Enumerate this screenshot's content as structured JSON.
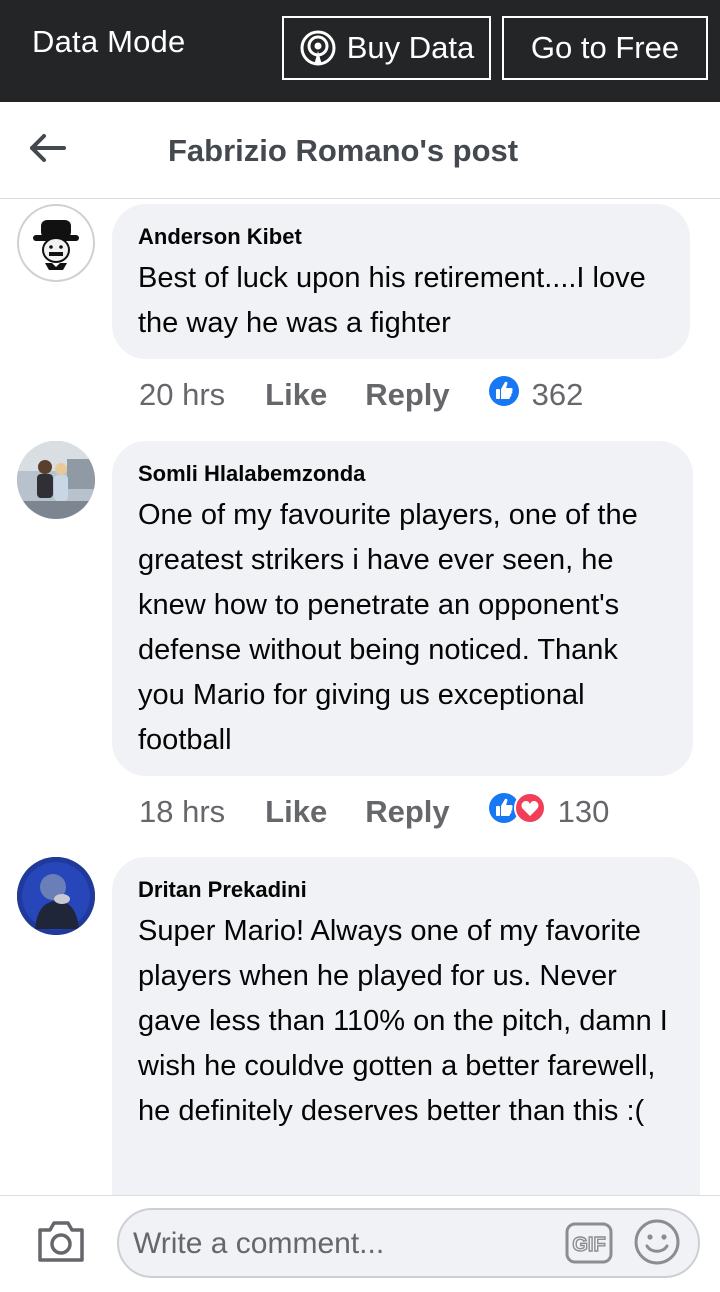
{
  "topbar": {
    "mode_label": "Data Mode",
    "buy_data_label": "Buy Data",
    "go_free_label": "Go to Free"
  },
  "header": {
    "title": "Fabrizio Romano's post"
  },
  "comments": [
    {
      "author": "Anderson Kibet",
      "text": "Best of luck upon his retirement....I love the way he was a fighter",
      "time": "20 hrs",
      "like_label": "Like",
      "reply_label": "Reply",
      "reactions": [
        "like"
      ],
      "reaction_count": "362"
    },
    {
      "author": "Somli Hlalabemzonda",
      "text": "One of my favourite players, one of the greatest strikers i have ever seen, he knew how to penetrate an opponent's defense without being noticed. Thank you Mario for giving us exceptional football",
      "time": "18 hrs",
      "like_label": "Like",
      "reply_label": "Reply",
      "reactions": [
        "like",
        "love"
      ],
      "reaction_count": "130"
    },
    {
      "author": "Dritan Prekadini",
      "text": "Super Mario! Always one of my favorite players when he played for us. Never gave less than 110% on the pitch, damn I wish he couldve gotten a better farewell, he definitely deserves better than this :(",
      "time": "",
      "like_label": "",
      "reply_label": "",
      "reactions": [],
      "reaction_count": ""
    }
  ],
  "composer": {
    "placeholder": "Write a comment..."
  },
  "colors": {
    "topbar_bg": "#242526",
    "bubble_bg": "#f0f2f5",
    "like_blue": "#1877f2",
    "love_red": "#f33e58",
    "meta_gray": "#65676b"
  },
  "icons": [
    "broadcast-icon",
    "back-arrow-icon",
    "like-reaction-icon",
    "love-reaction-icon",
    "camera-icon",
    "gif-icon",
    "smiley-icon"
  ]
}
